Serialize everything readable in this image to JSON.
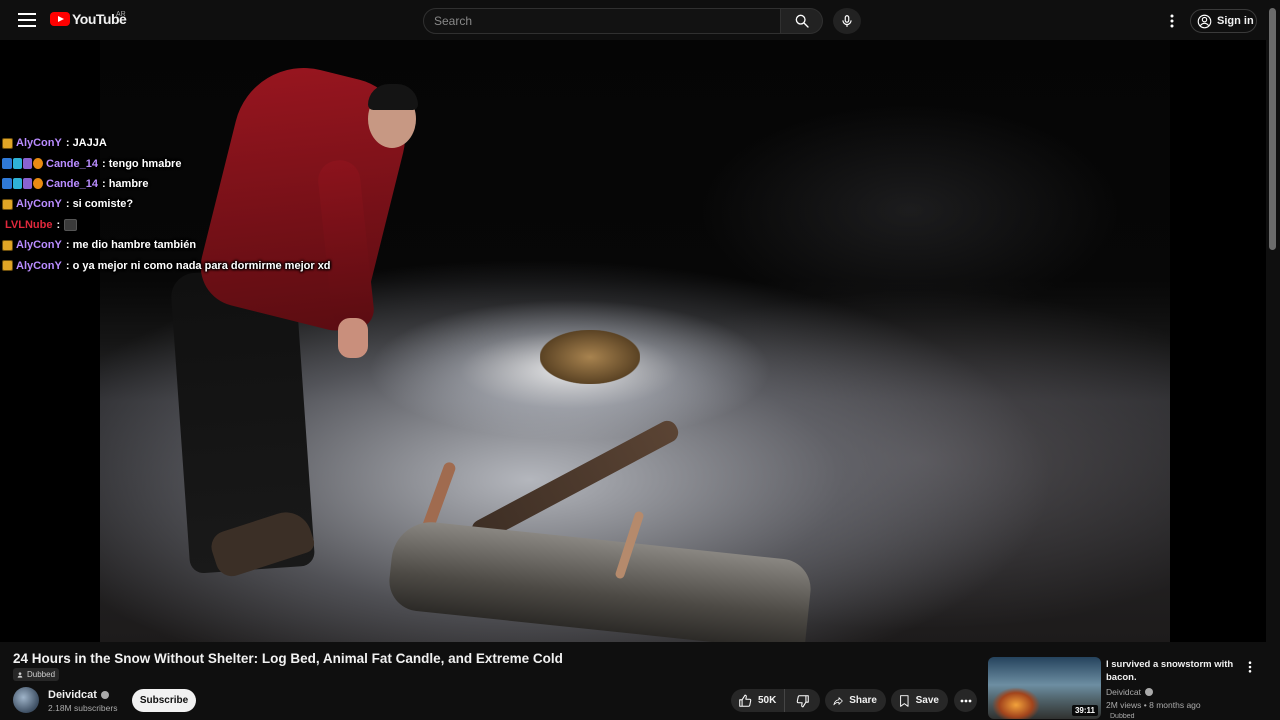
{
  "header": {
    "logo_text": "YouTube",
    "country_code": "AR",
    "search_placeholder": "Search",
    "signin_label": "Sign in"
  },
  "chat": [
    {
      "badges": [
        "gold"
      ],
      "user": "AlyConY",
      "user_color": "#b98cff",
      "message": ": JAJJA"
    },
    {
      "badges": [
        "blue",
        "cyan",
        "purple",
        "orange"
      ],
      "user": "Cande_14",
      "user_color": "#b98cff",
      "message": ": tengo hmabre"
    },
    {
      "badges": [
        "blue",
        "cyan",
        "purple",
        "orange"
      ],
      "user": "Cande_14",
      "user_color": "#b98cff",
      "message": ": hambre"
    },
    {
      "badges": [
        "gold"
      ],
      "user": "AlyConY",
      "user_color": "#b98cff",
      "message": ": si comiste?"
    },
    {
      "badges": [],
      "user": "LVLNube",
      "user_color": "#e0283c",
      "message": ":",
      "emote": true
    },
    {
      "badges": [
        "gold"
      ],
      "user": "AlyConY",
      "user_color": "#b98cff",
      "message": ": me dio hambre también"
    },
    {
      "badges": [
        "gold"
      ],
      "user": "AlyConY",
      "user_color": "#b98cff",
      "message": ": o ya mejor ni como nada para dormirme mejor xd"
    }
  ],
  "video": {
    "title": "24 Hours in the Snow Without Shelter: Log Bed, Animal Fat Candle, and Extreme Cold",
    "dubbed_label": "Dubbed",
    "channel": "Deividcat",
    "subscribers": "2.18M subscribers",
    "subscribe_label": "Subscribe",
    "likes": "50K",
    "share_label": "Share",
    "save_label": "Save"
  },
  "recommendation": {
    "title": "I survived a snowstorm with bacon.",
    "channel": "Deividcat",
    "meta": "2M views • 8 months ago",
    "duration": "39:11",
    "dubbed_label": "Dubbed"
  },
  "colors": {
    "background": "#0f0f0f",
    "brand_red": "#ff0000",
    "button_surface": "#272727"
  },
  "icons": [
    "menu-icon",
    "youtube-logo-icon",
    "search-icon",
    "mic-icon",
    "more-vert-icon",
    "account-icon",
    "thumb-up-icon",
    "thumb-down-icon",
    "share-icon",
    "bookmark-icon",
    "more-horiz-icon",
    "verified-icon",
    "dubbed-icon"
  ]
}
